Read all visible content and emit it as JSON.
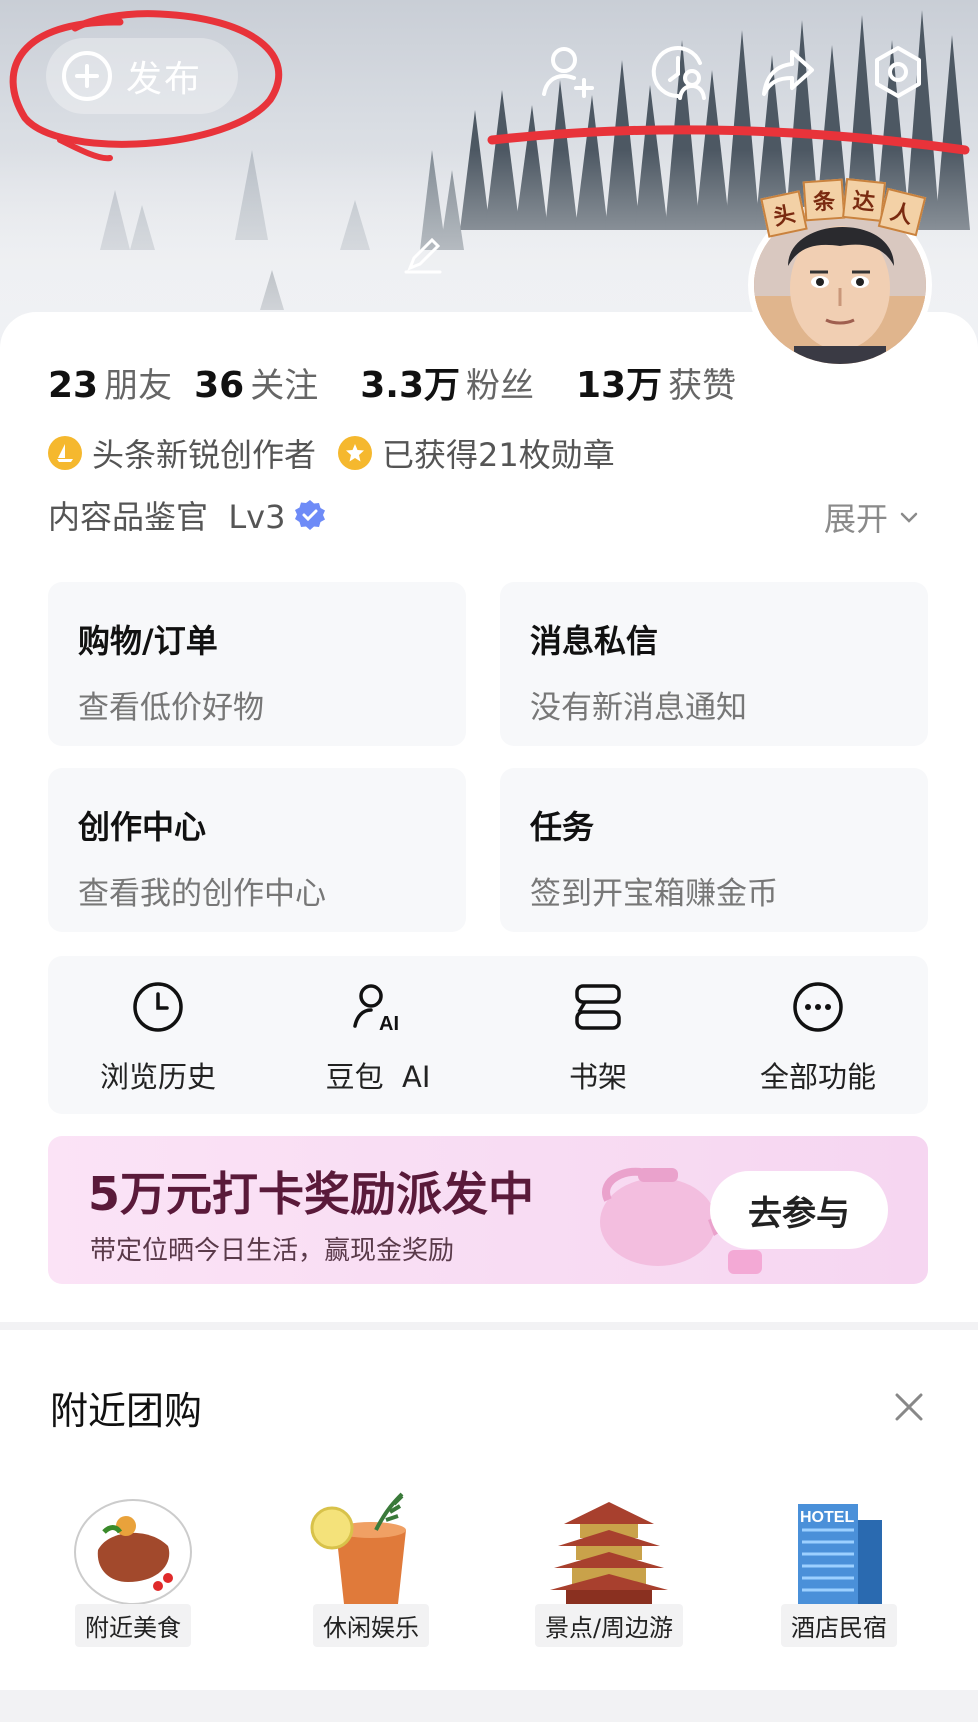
{
  "header": {
    "publish_label": "发布",
    "icons": [
      "add-friend-icon",
      "visitors-icon",
      "share-icon",
      "settings-icon"
    ]
  },
  "avatar": {
    "tag_chars": [
      "头",
      "条",
      "达",
      "人"
    ]
  },
  "stats": [
    {
      "num": "23",
      "unit": "朋友"
    },
    {
      "num": "36",
      "unit": "关注"
    },
    {
      "num": "3.3万",
      "unit": "粉丝"
    },
    {
      "num": "13万",
      "unit": "获赞"
    }
  ],
  "badges": {
    "creator": "头条新锐创作者",
    "medals": "已获得21枚勋章"
  },
  "level": {
    "text": "内容品鉴官  Lv3",
    "expand": "展开"
  },
  "tiles": [
    {
      "title": "购物/订单",
      "sub": "查看低价好物"
    },
    {
      "title": "消息私信",
      "sub": "没有新消息通知"
    },
    {
      "title": "创作中心",
      "sub": "查看我的创作中心"
    },
    {
      "title": "任务",
      "sub": "签到开宝箱赚金币"
    }
  ],
  "shortcuts": [
    {
      "label": "浏览历史",
      "icon": "clock-icon"
    },
    {
      "label": "豆包  AI",
      "icon": "ai-assistant-icon"
    },
    {
      "label": "书架",
      "icon": "bookshelf-icon"
    },
    {
      "label": "全部功能",
      "icon": "more-icon"
    }
  ],
  "promo": {
    "title": "5万元打卡奖励派发中",
    "sub": "带定位晒今日生活，赢现金奖励",
    "cta": "去参与"
  },
  "nearby": {
    "title": "附近团购",
    "items": [
      {
        "label": "附近美食",
        "icon": "food-icon"
      },
      {
        "label": "休闲娱乐",
        "icon": "drink-icon"
      },
      {
        "label": "景点/周边游",
        "icon": "pagoda-icon"
      },
      {
        "label": "酒店民宿",
        "icon": "hotel-icon"
      }
    ]
  },
  "colors": {
    "annotation_red": "#e8333a",
    "badge_gold": "#f5b82e",
    "verify_blue": "#6e8bf7",
    "promo_text": "#5a1a3a"
  }
}
